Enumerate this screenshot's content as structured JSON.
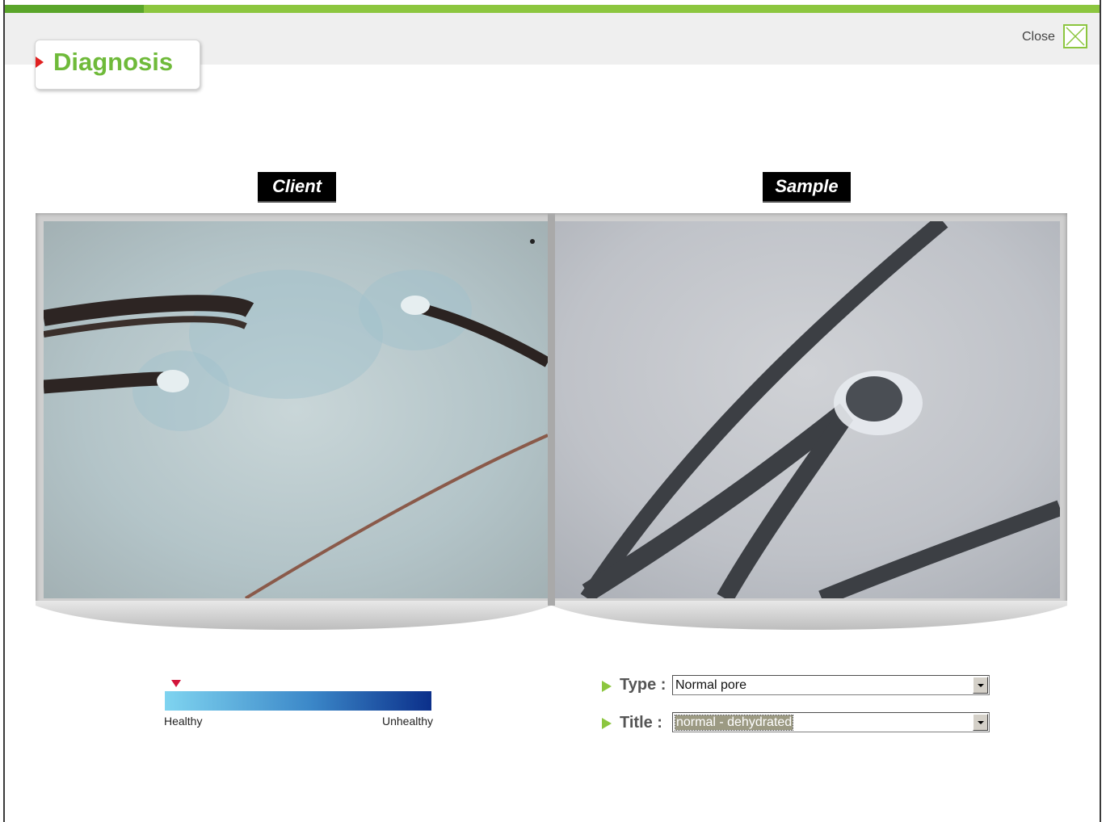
{
  "header": {
    "title": "Diagnosis",
    "close_label": "Close"
  },
  "viewer": {
    "client_caption": "Client",
    "sample_caption": "Sample"
  },
  "scale": {
    "healthy_label": "Healthy",
    "unhealthy_label": "Unhealthy",
    "marker_position": 0.02
  },
  "form": {
    "type_label": "Type :",
    "type_value": "Normal pore",
    "title_label": "Title :",
    "title_value": "normal - dehydrated"
  },
  "colors": {
    "accent_green": "#8cc63f",
    "title_green": "#6fba3a",
    "marker_red": "#d2143a",
    "scale_start": "#7fd4f0",
    "scale_end": "#0b2f8a"
  }
}
